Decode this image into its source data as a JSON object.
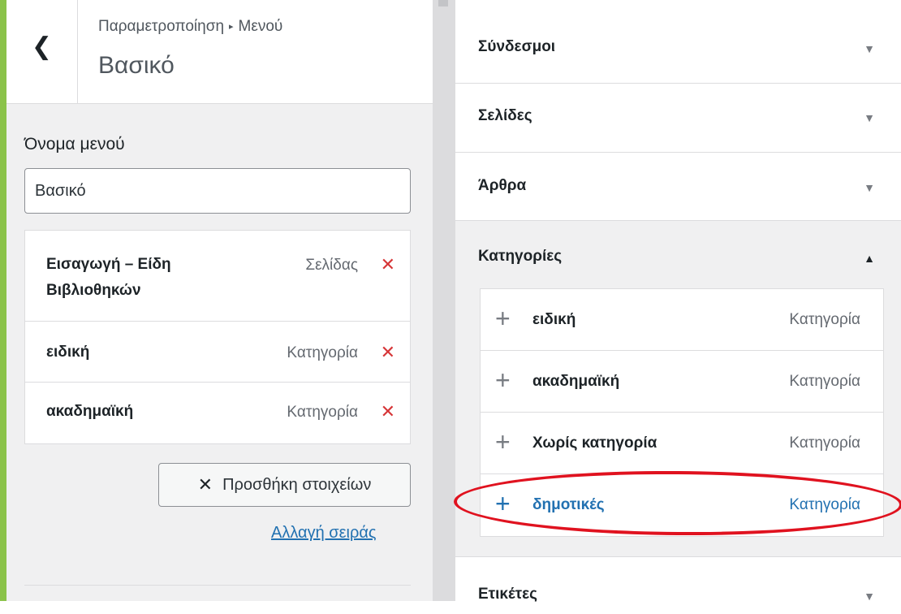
{
  "header": {
    "back_icon": "chevron-left-icon",
    "breadcrumb_parent": "Παραμετροποίηση",
    "breadcrumb_sep": "▸",
    "breadcrumb_current": "Μενού",
    "title": "Βασικό"
  },
  "menu_name": {
    "label": "Όνομα μενού",
    "value": "Βασικό"
  },
  "menu_items": [
    {
      "title_line1": "Εισαγωγή – Είδη",
      "title_line2": "Βιβλιοθηκών",
      "type": "Σελίδας",
      "remove": "✕"
    },
    {
      "title_line1": "ειδική",
      "type": "Κατηγορία",
      "remove": "✕"
    },
    {
      "title_line1": "ακαδημαϊκή",
      "type": "Κατηγορία",
      "remove": "✕"
    }
  ],
  "actions": {
    "add_items_icon": "✕",
    "add_items_label": "Προσθήκη στοιχείων",
    "reorder_label": "Αλλαγή σειράς"
  },
  "sections": [
    {
      "title": "Σύνδεσμοι",
      "arrow": "▼"
    },
    {
      "title": "Σελίδες",
      "arrow": "▼"
    },
    {
      "title": "Άρθρα",
      "arrow": "▼"
    },
    {
      "title": "Κατηγορίες",
      "arrow": "▲"
    },
    {
      "title": "Ετικέτες",
      "arrow": "▼"
    }
  ],
  "categories": [
    {
      "plus": "+",
      "title": "ειδική",
      "type": "Κατηγορία"
    },
    {
      "plus": "+",
      "title": "ακαδημαϊκή",
      "type": "Κατηγορία"
    },
    {
      "plus": "+",
      "title": "Χωρίς κατηγορία",
      "type": "Κατηγορία"
    },
    {
      "plus": "+",
      "title": "δημοτικές",
      "type": "Κατηγορία"
    }
  ],
  "colors": {
    "accent": "#2271b1",
    "remove": "#d63638",
    "highlight_ring": "#e0121f",
    "stripe": "#8bc34a"
  }
}
